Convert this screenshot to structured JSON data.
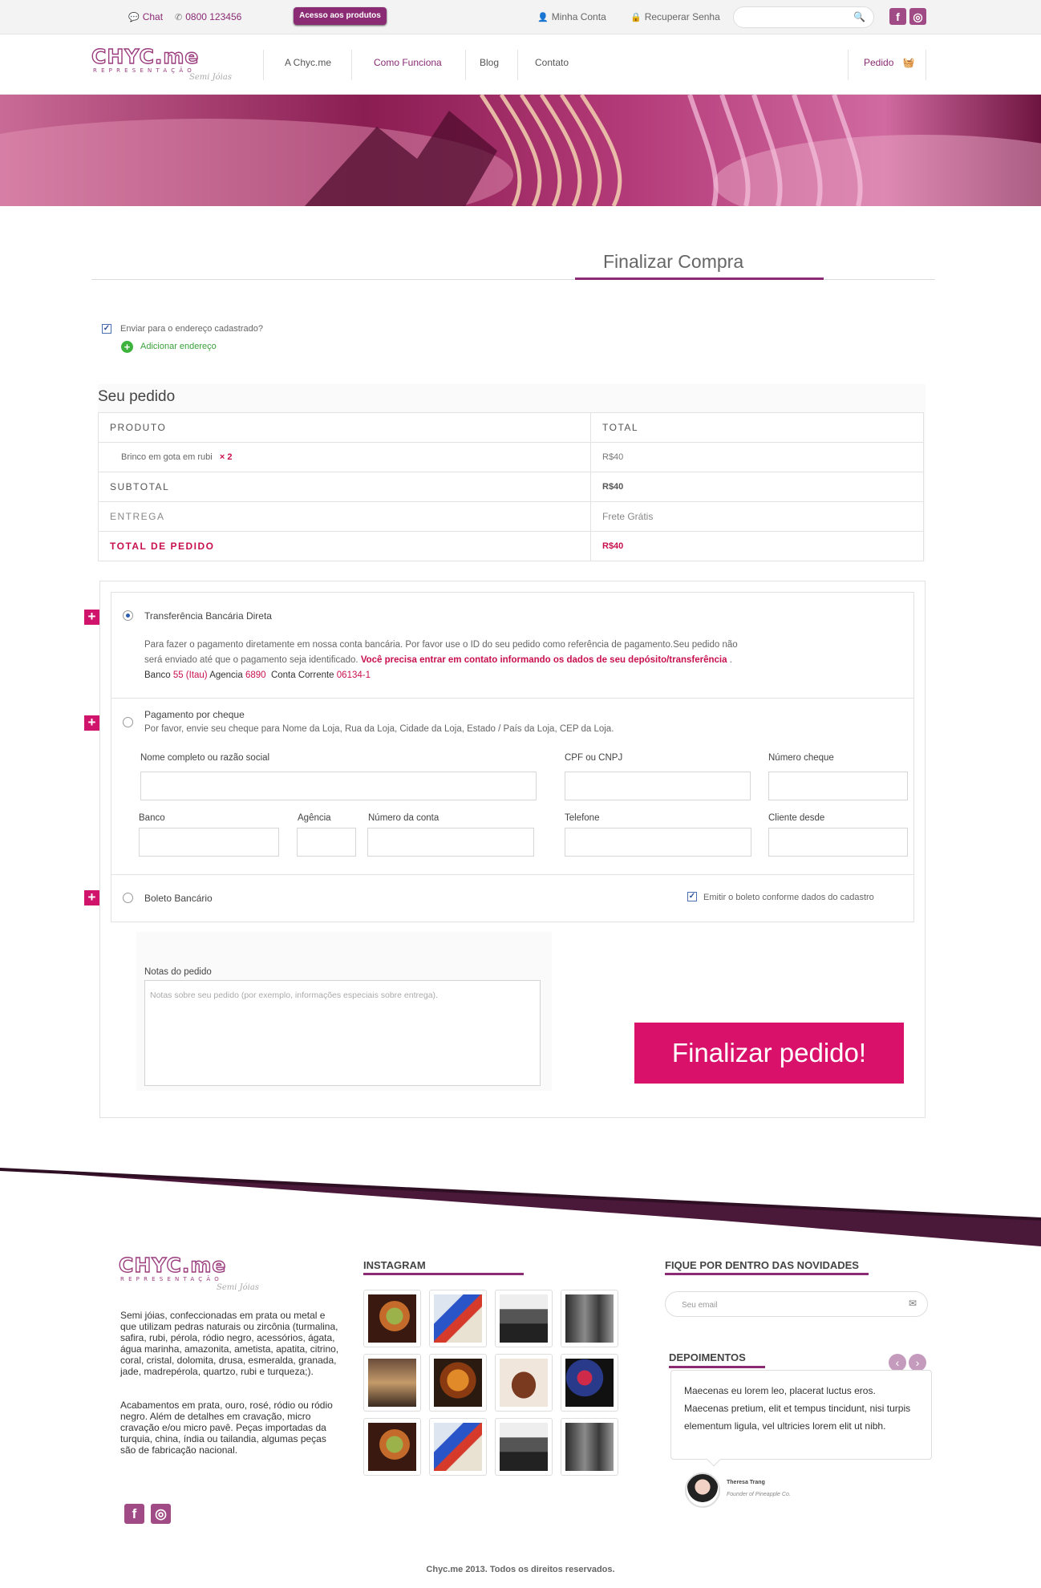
{
  "topbar": {
    "chat": "Chat",
    "phone": "0800 123456",
    "access_button": "Acesso aos produtos",
    "my_account": "Minha Conta",
    "recover_password": "Recuperar Senha",
    "search_placeholder": ""
  },
  "nav": {
    "logo_main": "CHYC.me",
    "logo_sub": "REPRESENTAÇÃO",
    "logo_script": "Semi Jóias",
    "items": [
      "A Chyc.me",
      "Como Funciona",
      "Blog",
      "Contato"
    ],
    "cart": "Pedido"
  },
  "page": {
    "title": "Finalizar Compra"
  },
  "address": {
    "send_label": "Enviar para o endereço cadastrado?",
    "add_label": "Adicionar endereço"
  },
  "order": {
    "title": "Seu pedido",
    "col_product": "PRODUTO",
    "col_total": "TOTAL",
    "item_name": "Brinco em gota em rubi",
    "item_qty": "× 2",
    "item_total": "R$40",
    "subtotal_label": "SUBTOTAL",
    "subtotal_value": "R$40",
    "shipping_label": "ENTREGA",
    "shipping_value": "Frete Grátis",
    "total_label": "TOTAL DE PEDIDO",
    "total_value": "R$40"
  },
  "payment": {
    "transfer_title": "Transferência Bancária Direta",
    "transfer_desc1": "Para fazer o pagamento diretamente em nossa conta bancária. Por favor use o ID do seu pedido como referência de pagamento.Seu pedido não",
    "transfer_desc2": "será enviado até que o pagamento seja identificado.",
    "transfer_highlight": "Você precisa entrar em contato informando os dados de seu depósito/transferência",
    "bank_label": "Banco",
    "bank_value": "55 (Itau)",
    "agency_label": "Agencia",
    "agency_value": "6890",
    "account_label": "Conta Corrente",
    "account_value": "06134-1",
    "cheque_title": "Pagamento por cheque",
    "cheque_desc": "Por favor, envie seu cheque para Nome da Loja, Rua da Loja, Cidade da Loja, Estado / País da Loja, CEP da Loja.",
    "fields": {
      "name": "Nome completo ou razão social",
      "cpf": "CPF ou CNPJ",
      "cheque_number": "Número cheque",
      "bank": "Banco",
      "agency": "Agência",
      "account_number": "Número da conta",
      "phone": "Telefone",
      "client_since": "Cliente desde"
    },
    "boleto_title": "Boleto Bancário",
    "boleto_option": "Emitir o boleto conforme dados do cadastro"
  },
  "notes": {
    "label": "Notas do pedido",
    "placeholder": "Notas sobre seu pedido (por exemplo, informações especiais sobre entrega)."
  },
  "submit": "Finalizar pedido!",
  "footer": {
    "about1": "Semi jóias, confeccionadas em prata ou metal e que utilizam pedras naturais ou zircônia (turmalina, safira, rubi, pérola, ródio negro, acessórios, ágata, água marinha, amazonita, ametista, apatita, citrino, coral, cristal, dolomita, drusa, esmeralda, granada, jade, madrepérola, quartzo, rubi e turqueza;).",
    "about2": "Acabamentos em prata, ouro, rosé, ródio ou ródio negro. Além de detalhes em cravação, micro cravação e/ou micro pavê. Peças importadas da turquia, china, índia ou tailandia, algumas peças são de fabricação nacional.",
    "instagram": "INSTAGRAM",
    "newsletter": "FIQUE POR DENTRO DAS NOVIDADES",
    "email_placeholder": "Seu email",
    "testimonials": "DEPOIMENTOS",
    "quote": "Maecenas eu lorem leo, placerat luctus eros. Maecenas pretium, elit et tempus tincidunt, nisi turpis elementum ligula, vel ultricies lorem elit ut nibh.",
    "author": "Theresa Trang",
    "author_role": "Founder of Pineapple Co.",
    "copyright": "Chyc.me 2013. Todos os direitos reservados."
  },
  "colors": {
    "brand": "#8a2b74",
    "accent": "#d9116b",
    "highlight": "#c8104f"
  }
}
